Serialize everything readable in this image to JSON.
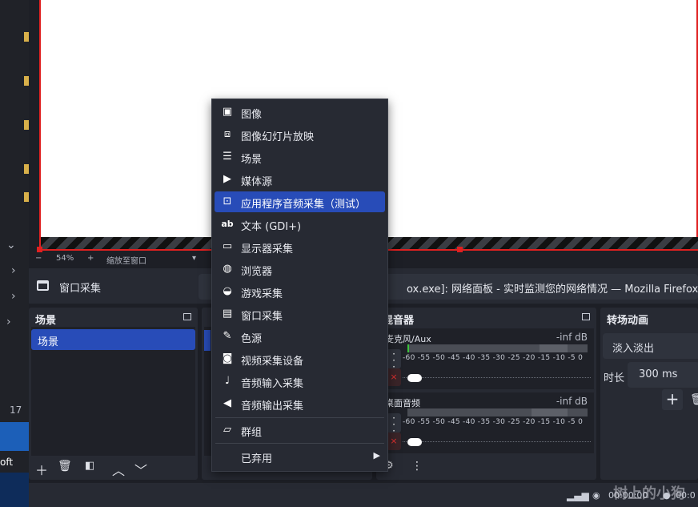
{
  "preview": {
    "zoom_minus": "−",
    "zoom_value": "54%",
    "zoom_plus": "+",
    "zoom_mode": "缩放至窗口"
  },
  "source_toolbar": {
    "source_name": "窗口采集",
    "window_combo": "ox.exe]: 网络面板 - 实时监测您的网络情况 — Mozilla Firefox"
  },
  "scenes": {
    "title": "场景",
    "items": [
      "场景"
    ]
  },
  "mixer": {
    "title": "混音器",
    "tracks": [
      {
        "label": "麦克风/Aux",
        "db": "-inf dB"
      },
      {
        "label": "桌面音频",
        "db": "-inf dB"
      }
    ],
    "ticks": "-60 -55 -50 -45 -40 -35 -30 -25 -20 -15 -10 -5 0"
  },
  "transitions": {
    "title": "转场动画",
    "selected": "淡入淡出",
    "duration_label": "时长",
    "duration_value": "300 ms"
  },
  "status": {
    "time1": "00:00:00",
    "time2": "00:0"
  },
  "desktop": {
    "left_number": "17",
    "left_text": "oft"
  },
  "context_menu": {
    "items": [
      {
        "label": "图像",
        "icon": "image-icon"
      },
      {
        "label": "图像幻灯片放映",
        "icon": "slideshow-icon"
      },
      {
        "label": "场景",
        "icon": "list-icon"
      },
      {
        "label": "媒体源",
        "icon": "play-icon"
      },
      {
        "label": "应用程序音频采集（测试）",
        "icon": "app-audio-icon"
      },
      {
        "label": "文本 (GDI+)",
        "icon": "text-icon"
      },
      {
        "label": "显示器采集",
        "icon": "monitor-icon"
      },
      {
        "label": "浏览器",
        "icon": "globe-icon"
      },
      {
        "label": "游戏采集",
        "icon": "gamepad-icon"
      },
      {
        "label": "窗口采集",
        "icon": "window-icon"
      },
      {
        "label": "色源",
        "icon": "brush-icon"
      },
      {
        "label": "视频采集设备",
        "icon": "camera-icon"
      },
      {
        "label": "音频输入采集",
        "icon": "microphone-icon"
      },
      {
        "label": "音频输出采集",
        "icon": "speaker-icon"
      },
      {
        "label": "群组",
        "icon": "folder-icon"
      },
      {
        "label": "已弃用",
        "icon": ""
      }
    ],
    "active_index": 4
  },
  "watermark": "树上的小狗"
}
